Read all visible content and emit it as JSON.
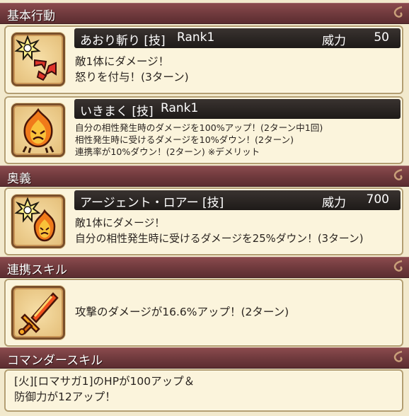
{
  "sections": {
    "basic": "基本行動",
    "ougi": "奥義",
    "renkei": "連携スキル",
    "commander": "コマンダースキル"
  },
  "skill1": {
    "name": "あおり斬り [技]",
    "rank": "Rank1",
    "power_label": "威力",
    "power": "50",
    "lines": [
      "敵1体にダメージ！",
      "怒りを付与！(3ターン)"
    ]
  },
  "skill2": {
    "name": "いきまく [技]",
    "rank": "Rank1",
    "lines": [
      "自分の相性発生時のダメージを100%アップ！(2ターン中1回)",
      "相性発生時に受けるダメージを10%ダウン！(2ターン)",
      "連携率が10%ダウン！(2ターン) ※デメリット"
    ]
  },
  "ougi": {
    "name": "アージェント・ロアー [技]",
    "power_label": "威力",
    "power": "700",
    "lines": [
      "敵1体にダメージ！",
      "自分の相性発生時に受けるダメージを25%ダウン！(3ターン)"
    ]
  },
  "renkei": {
    "line": "攻撃のダメージが16.6%アップ！(2ターン)"
  },
  "commander": {
    "lines": [
      "[火][ロマサガ1]のHPが100アップ＆",
      "防御力が12アップ！"
    ]
  },
  "icons": {
    "skill1": "burst-anger-icon",
    "skill2": "fire-rage-icon",
    "ougi": "burst-fire-rage-icon",
    "renkei": "flame-sword-icon"
  },
  "colors": {
    "header": "#7a4144",
    "card_bg": "#fbf4dc",
    "title_bar": "#2a2422"
  }
}
